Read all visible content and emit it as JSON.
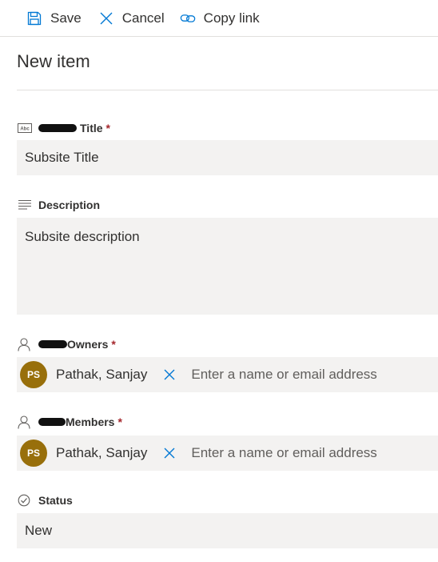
{
  "toolbar": {
    "save_label": "Save",
    "cancel_label": "Cancel",
    "copy_link_label": "Copy link"
  },
  "panel": {
    "title": "New item"
  },
  "fields": {
    "title": {
      "label": "Title",
      "required_marker": "*",
      "icon": "text-field-icon",
      "value": "Subsite Title"
    },
    "description": {
      "label": "Description",
      "icon": "multiline-text-icon",
      "value": "Subsite description"
    },
    "owners": {
      "label": "Owners",
      "required_marker": "*",
      "icon": "person-icon",
      "persona": {
        "initials": "PS",
        "name": "Pathak, Sanjay",
        "avatar_color": "#986f0b"
      },
      "placeholder": "Enter a name or email address"
    },
    "members": {
      "label": "Members",
      "required_marker": "*",
      "icon": "person-icon",
      "persona": {
        "initials": "PS",
        "name": "Pathak, Sanjay",
        "avatar_color": "#986f0b"
      },
      "placeholder": "Enter a name or email address"
    },
    "status": {
      "label": "Status",
      "icon": "choice-check-icon",
      "value": "New"
    }
  },
  "colors": {
    "accent": "#0078d4",
    "required": "#a4262c",
    "field_background": "#f3f2f1"
  }
}
